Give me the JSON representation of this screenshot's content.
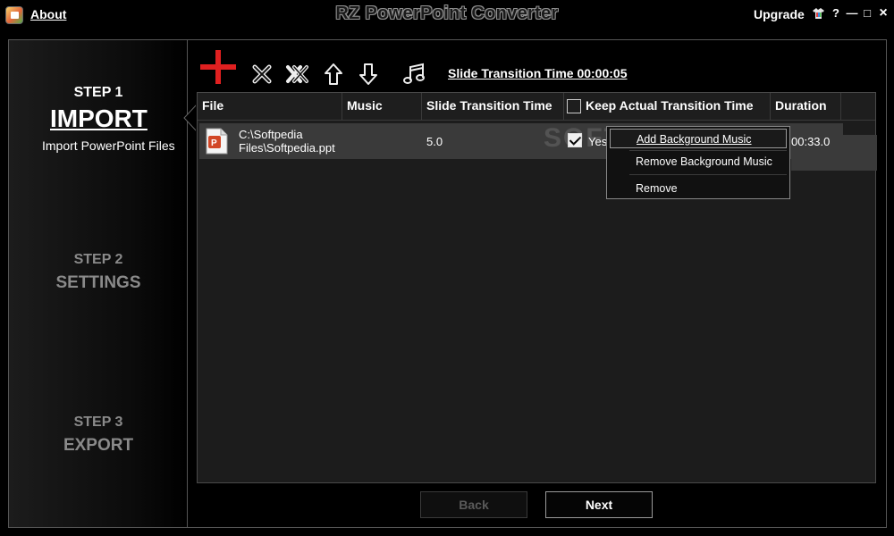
{
  "titlebar": {
    "about_label": "About",
    "title": "RZ PowerPoint Converter",
    "upgrade_label": "Upgrade",
    "help_symbol": "?",
    "minimize_symbol": "—",
    "maximize_symbol": "□",
    "close_symbol": "×"
  },
  "steps": {
    "step1": {
      "num": "STEP 1",
      "name": "IMPORT",
      "desc": "Import PowerPoint Files"
    },
    "step2": {
      "num": "STEP 2",
      "name": "SETTINGS"
    },
    "step3": {
      "num": "STEP 3",
      "name": "EXPORT"
    }
  },
  "toolbar": {
    "icons": [
      "add-icon",
      "remove-icon",
      "remove-all-icon",
      "move-up-icon",
      "move-down-icon",
      "music-icon"
    ],
    "slide_transition_label": "Slide Transition Time 00:00:05"
  },
  "table": {
    "columns": [
      "File",
      "Music",
      "Slide Transition Time",
      "Keep Actual Transition Time",
      "Duration"
    ],
    "rows": [
      {
        "file_line1": "C:\\Softpedia",
        "file_line2": "Files\\Softpedia.ppt",
        "music": "",
        "slide_transition_time": "5.0",
        "keep_actual": "Yes",
        "keep_checked": true,
        "duration": "00:33.0"
      }
    ]
  },
  "context_menu": {
    "items": [
      "Add Background Music",
      "Remove Background Music",
      "Remove"
    ]
  },
  "watermark": "SOFTPEDIA",
  "buttons": {
    "back": "Back",
    "next": "Next"
  },
  "colors": {
    "accent_red": "#e02020",
    "background": "#000000",
    "row_selected": "#3a3a3a"
  }
}
